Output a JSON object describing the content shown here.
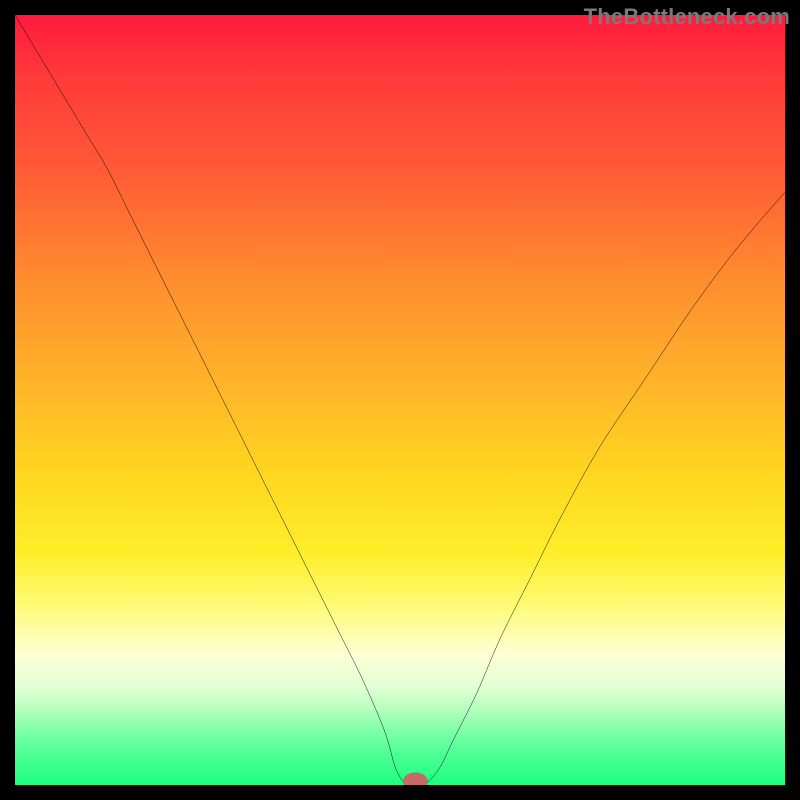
{
  "watermark": "TheBottleneck.com",
  "chart_data": {
    "type": "line",
    "title": "",
    "xlabel": "",
    "ylabel": "",
    "xlim": [
      0,
      100
    ],
    "ylim": [
      0,
      100
    ],
    "background_gradient": {
      "orientation": "vertical",
      "stops": [
        {
          "pos": 0,
          "color": "#ff1a3c"
        },
        {
          "pos": 8,
          "color": "#ff3a3a"
        },
        {
          "pos": 20,
          "color": "#ff5a36"
        },
        {
          "pos": 35,
          "color": "#ff8f2e"
        },
        {
          "pos": 48,
          "color": "#ffb429"
        },
        {
          "pos": 60,
          "color": "#ffd71f"
        },
        {
          "pos": 70,
          "color": "#feee2a"
        },
        {
          "pos": 77,
          "color": "#fffb7a"
        },
        {
          "pos": 83,
          "color": "#fdffd4"
        },
        {
          "pos": 87,
          "color": "#e4ffd6"
        },
        {
          "pos": 90,
          "color": "#b8ffc0"
        },
        {
          "pos": 93,
          "color": "#7effa8"
        },
        {
          "pos": 96,
          "color": "#4dff94"
        },
        {
          "pos": 100,
          "color": "#1cff7e"
        }
      ]
    },
    "series": [
      {
        "name": "bottleneck-curve",
        "color": "#000000",
        "stroke_width": 3,
        "x": [
          0,
          3,
          6,
          9,
          12,
          15,
          18,
          21,
          24,
          27,
          30,
          33,
          36,
          39,
          42,
          45,
          48,
          49.5,
          51,
          53,
          55,
          57,
          60,
          63,
          67,
          71,
          76,
          82,
          88,
          94,
          100
        ],
        "y": [
          100,
          95,
          90,
          85,
          80,
          74,
          68,
          62,
          56,
          50,
          44,
          38,
          32,
          26,
          20,
          14,
          7,
          2,
          0,
          0,
          2,
          6,
          12,
          19,
          27,
          35,
          44,
          53,
          62,
          70,
          77
        ]
      }
    ],
    "marker": {
      "name": "bottleneck-point",
      "x": 52,
      "y": 0.5,
      "rx": 1.6,
      "ry": 1.1,
      "fill": "#c96a66",
      "stroke": "#7a3c38"
    }
  }
}
